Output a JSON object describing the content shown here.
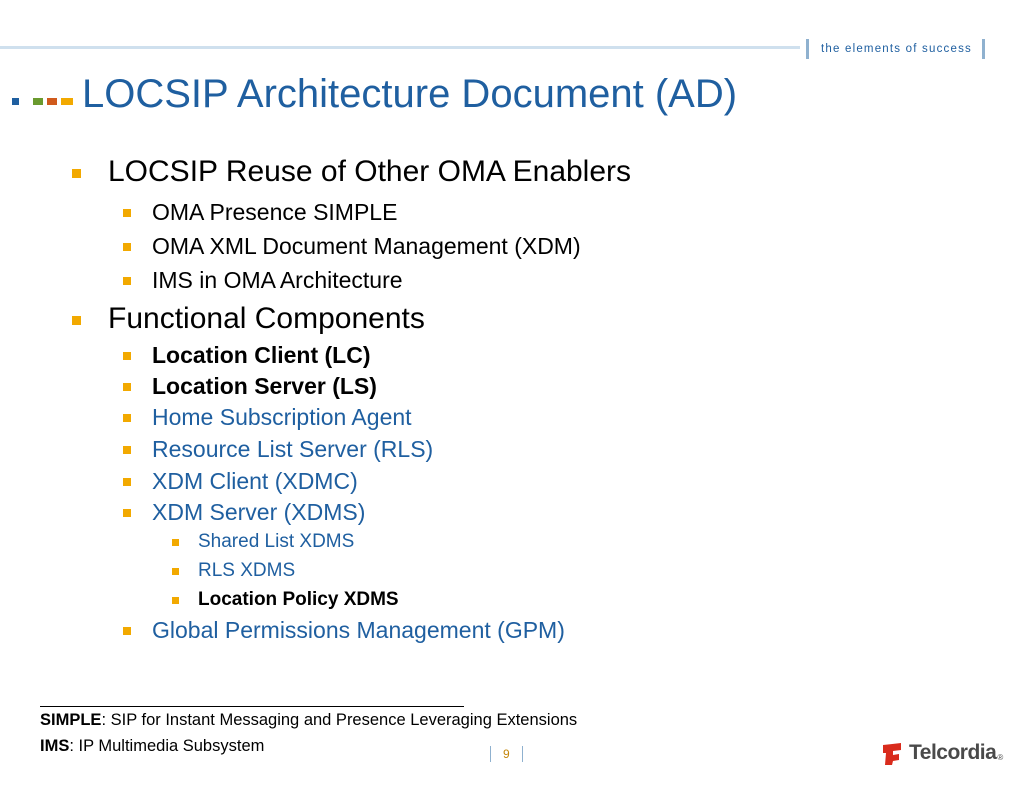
{
  "header": {
    "tagline": "the elements of success",
    "title": "LOCSIP Architecture Document (AD)"
  },
  "bullets": [
    {
      "level": 1,
      "text": "LOCSIP Reuse of Other OMA Enablers",
      "bold": false,
      "color": "#000000"
    },
    {
      "level": 2,
      "text": "OMA Presence SIMPLE",
      "bold": false,
      "color": "#000000"
    },
    {
      "level": 2,
      "text": "OMA XML Document Management (XDM)",
      "bold": false,
      "color": "#000000"
    },
    {
      "level": 2,
      "text": "IMS in OMA Architecture",
      "bold": false,
      "color": "#000000"
    },
    {
      "level": 1,
      "text": "Functional Components",
      "bold": false,
      "color": "#000000"
    },
    {
      "level": 2,
      "text": "Location Client (LC)",
      "bold": true,
      "color": "#000000"
    },
    {
      "level": 2,
      "text": "Location Server (LS)",
      "bold": true,
      "color": "#000000"
    },
    {
      "level": 2,
      "text": "Home Subscription Agent",
      "bold": false,
      "color": "#1f5fa0"
    },
    {
      "level": 2,
      "text": "Resource List Server (RLS)",
      "bold": false,
      "color": "#1f5fa0"
    },
    {
      "level": 2,
      "text": "XDM Client (XDMC)",
      "bold": false,
      "color": "#1f5fa0"
    },
    {
      "level": 2,
      "text": "XDM Server (XDMS)",
      "bold": false,
      "color": "#1f5fa0"
    },
    {
      "level": 3,
      "text": "Shared List XDMS",
      "bold": false,
      "color": "#1f5fa0"
    },
    {
      "level": 3,
      "text": "RLS XDMS",
      "bold": false,
      "color": "#1f5fa0"
    },
    {
      "level": 3,
      "text": "Location Policy XDMS",
      "bold": true,
      "color": "#000000"
    },
    {
      "level": 2,
      "text": "Global Permissions Management (GPM)",
      "bold": false,
      "color": "#1f5fa0"
    }
  ],
  "footnotes": [
    {
      "term": "SIMPLE",
      "definition": ": SIP for Instant Messaging and Presence Leveraging Extensions"
    },
    {
      "term": "IMS",
      "definition": ":  IP Multimedia Subsystem"
    }
  ],
  "footer": {
    "page_number": "9",
    "logo_text": "Telcordia",
    "logo_reg": "®"
  },
  "colors": {
    "accent_blue": "#1f5fa0",
    "bullet_gold": "#f2a900",
    "logo_red": "#d92b1c"
  }
}
